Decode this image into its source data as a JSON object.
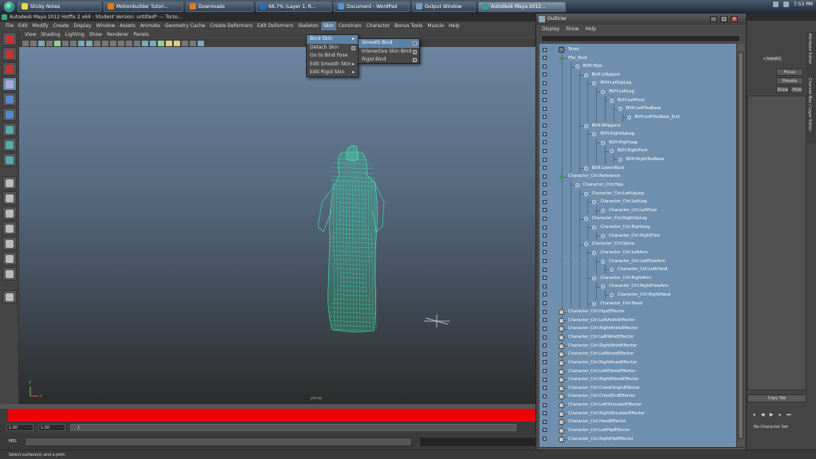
{
  "taskbar": {
    "items": [
      {
        "label": "Sticky Notes",
        "color": "#e8d84a"
      },
      {
        "label": "Motionbuilder Tutori...",
        "color": "#e07a20"
      },
      {
        "label": "Downloads",
        "color": "#e07a20"
      },
      {
        "label": "66.7% (Layer 1, R...",
        "color": "#2a6fb5"
      },
      {
        "label": "Document - WordPad",
        "color": "#5b8fd0"
      },
      {
        "label": "Output Window",
        "color": "#7a9ab8"
      },
      {
        "label": "Autodesk Maya 2012...",
        "color": "#3a9b8b",
        "active": true
      }
    ],
    "clock": "7:53 PM"
  },
  "maya": {
    "title": "Autodesk Maya 2012 Hotfix 2 x64 - Student Version: untitled*   ---   Torso...",
    "menus": [
      "File",
      "Edit",
      "Modify",
      "Create",
      "Display",
      "Window",
      "Assets",
      "Animate",
      "Geometry Cache",
      "Create Deformers",
      "Edit Deformers",
      "Skeleton",
      "Skin",
      "Constrain",
      "Character",
      "Bonus Tools",
      "Muscle",
      "Help"
    ],
    "open_menu": "Skin",
    "panel_menus": [
      "View",
      "Shading",
      "Lighting",
      "Show",
      "Renderer",
      "Panels"
    ],
    "viewport_label": "persp",
    "axis": {
      "x": "x",
      "y": "y"
    },
    "range": {
      "start": "1.00",
      "start2": "1.00",
      "current": "1"
    },
    "mel_label": "MEL",
    "helpline": "Select surface(s) and a joint."
  },
  "skin_menu": {
    "items": [
      {
        "label": "Bind Skin",
        "arrow": "▸",
        "highlight": true
      },
      {
        "label": "Detach Skin",
        "box": true
      },
      {
        "label": "Go to Bind Pose"
      },
      {
        "label": "Edit Smooth Skin",
        "arrow": "▸"
      },
      {
        "label": "Edit Rigid Skin",
        "arrow": "▸"
      }
    ],
    "submenu": [
      {
        "label": "Smooth Bind",
        "highlight": true
      },
      {
        "label": "Interactive Skin Bind"
      },
      {
        "label": "Rigid Bind"
      }
    ]
  },
  "outliner": {
    "title": "Outliner",
    "menus": [
      "Display",
      "Show",
      "Help"
    ],
    "rows": [
      {
        "label": "Torso",
        "depth": 0,
        "icon": "mesh"
      },
      {
        "label": "Fbx_Root",
        "depth": 0,
        "icon": "root"
      },
      {
        "label": "BVH:Hips",
        "depth": 1,
        "icon": "joint"
      },
      {
        "label": "BVH:LHipJoint",
        "depth": 2,
        "icon": "joint"
      },
      {
        "label": "BVH:LeftUpLeg",
        "depth": 3,
        "icon": "joint"
      },
      {
        "label": "BVH:LeftLeg",
        "depth": 4,
        "icon": "joint"
      },
      {
        "label": "BVH:LeftFoot",
        "depth": 5,
        "icon": "joint"
      },
      {
        "label": "BVH:LeftToeBase",
        "depth": 6,
        "icon": "joint"
      },
      {
        "label": "BVH:LeftToeBase_End",
        "depth": 7,
        "icon": "joint"
      },
      {
        "label": "BVH:RHipJoint",
        "depth": 2,
        "icon": "joint"
      },
      {
        "label": "BVH:RightUpLeg",
        "depth": 3,
        "icon": "joint"
      },
      {
        "label": "BVH:RightLeg",
        "depth": 4,
        "icon": "joint"
      },
      {
        "label": "BVH:RightFoot",
        "depth": 5,
        "icon": "joint"
      },
      {
        "label": "BVH:RightToeBase",
        "depth": 6,
        "icon": "joint"
      },
      {
        "label": "BVH:LowerBack",
        "depth": 2,
        "icon": "joint"
      },
      {
        "label": "Character_Ctrl:Reference",
        "depth": 0,
        "icon": "root"
      },
      {
        "label": "Character_Ctrl:Hips",
        "depth": 1,
        "icon": "joint"
      },
      {
        "label": "Character_Ctrl:LeftUpLeg",
        "depth": 2,
        "icon": "joint"
      },
      {
        "label": "Character_Ctrl:LeftLeg",
        "depth": 3,
        "icon": "joint"
      },
      {
        "label": "Character_Ctrl:LeftFoot",
        "depth": 4,
        "icon": "joint"
      },
      {
        "label": "Character_Ctrl:RightUpLeg",
        "depth": 2,
        "icon": "joint"
      },
      {
        "label": "Character_Ctrl:RightLeg",
        "depth": 3,
        "icon": "joint"
      },
      {
        "label": "Character_Ctrl:RightFoot",
        "depth": 4,
        "icon": "joint"
      },
      {
        "label": "Character_Ctrl:Spine",
        "depth": 2,
        "icon": "joint"
      },
      {
        "label": "Character_Ctrl:LeftArm",
        "depth": 3,
        "icon": "joint"
      },
      {
        "label": "Character_Ctrl:LeftForeArm",
        "depth": 4,
        "icon": "joint"
      },
      {
        "label": "Character_Ctrl:LeftHand",
        "depth": 5,
        "icon": "joint"
      },
      {
        "label": "Character_Ctrl:RightArm",
        "depth": 3,
        "icon": "joint"
      },
      {
        "label": "Character_Ctrl:RightForeArm",
        "depth": 4,
        "icon": "joint"
      },
      {
        "label": "Character_Ctrl:RightHand",
        "depth": 5,
        "icon": "joint"
      },
      {
        "label": "Character_Ctrl:Head",
        "depth": 3,
        "icon": "joint"
      },
      {
        "label": "Character_Ctrl:HipsEffector",
        "depth": 0,
        "icon": "effector"
      },
      {
        "label": "Character_Ctrl:LeftAnkleEffector",
        "depth": 0,
        "icon": "effector"
      },
      {
        "label": "Character_Ctrl:RightAnkleEffector",
        "depth": 0,
        "icon": "effector"
      },
      {
        "label": "Character_Ctrl:LeftWristEffector",
        "depth": 0,
        "icon": "effector"
      },
      {
        "label": "Character_Ctrl:RightWristEffector",
        "depth": 0,
        "icon": "effector"
      },
      {
        "label": "Character_Ctrl:LeftKneeEffector",
        "depth": 0,
        "icon": "effector"
      },
      {
        "label": "Character_Ctrl:RightKneeEffector",
        "depth": 0,
        "icon": "effector"
      },
      {
        "label": "Character_Ctrl:LeftElbowEffector",
        "depth": 0,
        "icon": "effector"
      },
      {
        "label": "Character_Ctrl:RightElbowEffector",
        "depth": 0,
        "icon": "effector"
      },
      {
        "label": "Character_Ctrl:ChestOriginEffector",
        "depth": 0,
        "icon": "effector"
      },
      {
        "label": "Character_Ctrl:ChestEndEffector",
        "depth": 0,
        "icon": "effector"
      },
      {
        "label": "Character_Ctrl:LeftShoulderEffector",
        "depth": 0,
        "icon": "effector"
      },
      {
        "label": "Character_Ctrl:RightShoulderEffector",
        "depth": 0,
        "icon": "effector"
      },
      {
        "label": "Character_Ctrl:HeadEffector",
        "depth": 0,
        "icon": "effector"
      },
      {
        "label": "Character_Ctrl:LeftHipEffector",
        "depth": 0,
        "icon": "effector"
      },
      {
        "label": "Character_Ctrl:RightHipEffector",
        "depth": 0,
        "icon": "effector"
      }
    ]
  },
  "right_panel": {
    "tab_layer": "er1",
    "tab_tweak": "tweak1",
    "focus": "Focus",
    "presets": "Presets",
    "show": "Show",
    "hide": "Hide",
    "copy_tab": "Copy Tab",
    "no_char_set": "No Character Set",
    "vtab_attr": "Attribute Editor",
    "vtab_channel": "Channel Box / Layer Editor"
  },
  "colors": {
    "wireframe": "#3df2b0",
    "timeslider": "#e00000",
    "outliner_bg": "#6f8fae",
    "menu_highlight": "#5d82a8"
  }
}
